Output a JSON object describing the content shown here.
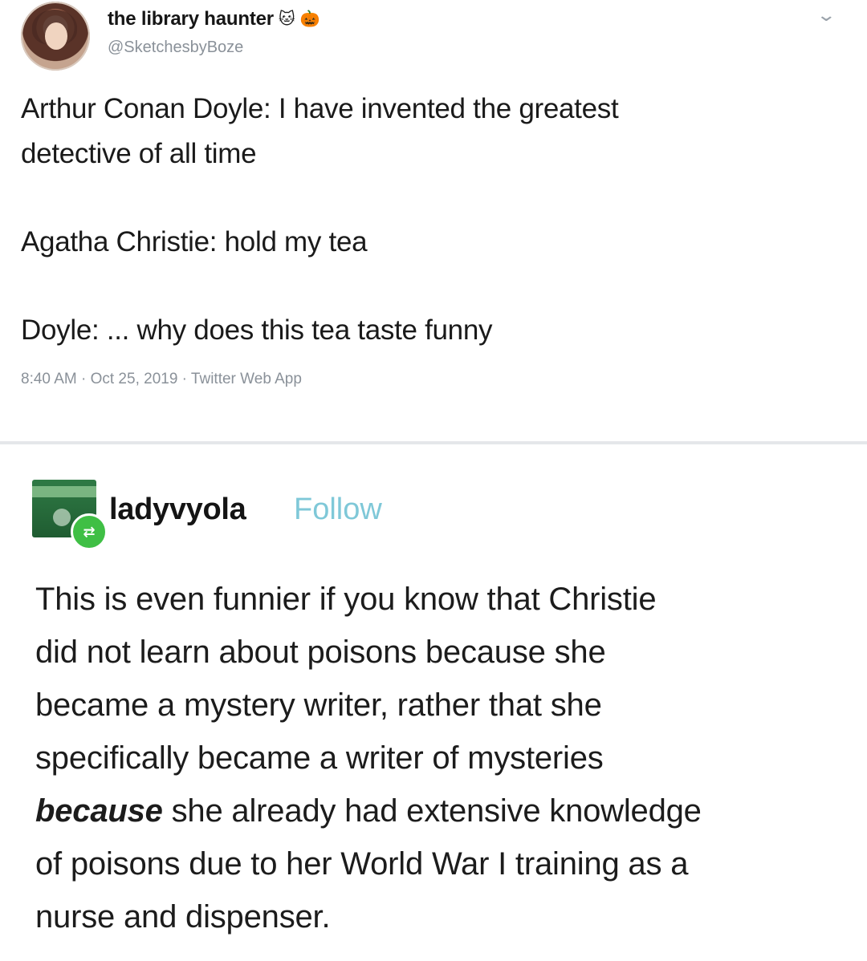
{
  "tweet": {
    "display_name": "the library haunter",
    "name_emojis": [
      "🐱",
      "🎃"
    ],
    "handle": "@SketchesbyBoze",
    "lines": [
      "Arthur Conan Doyle: I have invented the greatest",
      "detective of all time",
      "Agatha Christie: hold my tea",
      "Doyle: ... why does this tea taste funny"
    ],
    "meta": "8:40 AM · Oct 25, 2019 · Twitter Web App",
    "chevron": "⌄"
  },
  "reply": {
    "username": "ladyvyola",
    "follow_label": "Follow",
    "badge_icon": "⇄",
    "lines": [
      "This is even funnier if you know that Christie",
      "did not learn about poisons because she",
      "became a mystery writer, rather that she",
      "specifically became a writer of mysteries",
      "because",
      " she already had extensive knowledge",
      "of poisons due to her World War I training as a",
      "nurse and dispenser."
    ]
  },
  "colors": {
    "follow": "#7fc8d8",
    "meta_gray": "#8a9199",
    "badge_green": "#3fbf45"
  }
}
